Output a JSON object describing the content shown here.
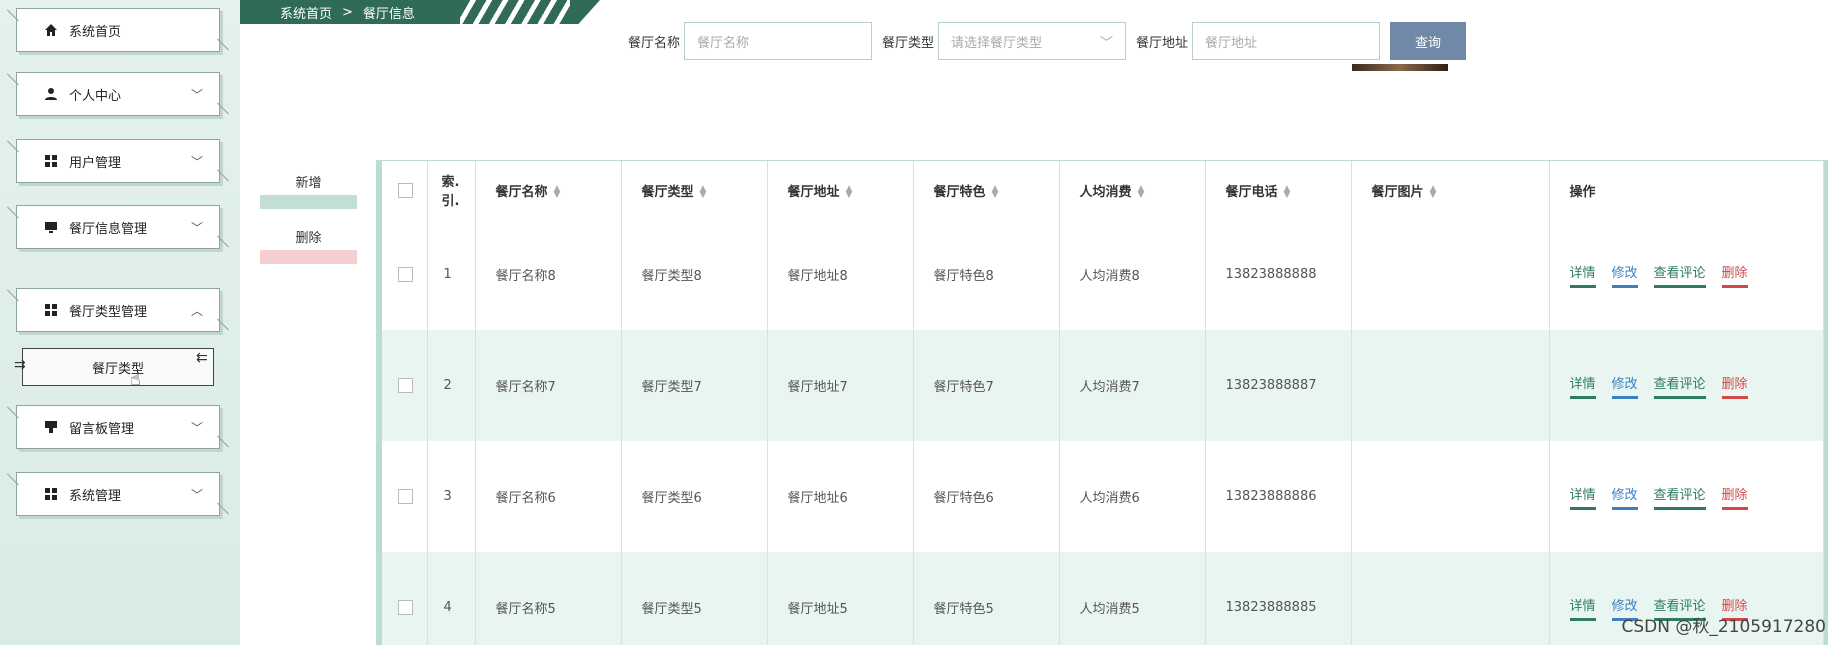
{
  "sidebar": {
    "items": [
      {
        "label": "系统首页",
        "icon": "home-icon",
        "chevron": ""
      },
      {
        "label": "个人中心",
        "icon": "user-icon",
        "chevron": "﹀"
      },
      {
        "label": "用户管理",
        "icon": "grid-icon",
        "chevron": "﹀"
      },
      {
        "label": "餐厅信息管理",
        "icon": "monitor-icon",
        "chevron": "﹀"
      },
      {
        "label": "餐厅类型管理",
        "icon": "grid-icon",
        "chevron": "︿"
      },
      {
        "label": "留言板管理",
        "icon": "board-icon",
        "chevron": "﹀"
      },
      {
        "label": "系统管理",
        "icon": "grid-icon",
        "chevron": "﹀"
      }
    ],
    "subitem": {
      "label": "餐厅类型"
    }
  },
  "breadcrumb": {
    "home": "系统首页",
    "separator": ">",
    "current": "餐厅信息"
  },
  "search": {
    "name_label": "餐厅名称",
    "name_placeholder": "餐厅名称",
    "type_label": "餐厅类型",
    "type_placeholder": "请选择餐厅类型",
    "address_label": "餐厅地址",
    "address_placeholder": "餐厅地址",
    "query_button": "查询"
  },
  "actions": {
    "add": "新增",
    "delete": "删除",
    "add_color": "#c3ded4",
    "delete_color": "#f5cfcf"
  },
  "table": {
    "columns": [
      "索.引.",
      "餐厅名称",
      "餐厅类型",
      "餐厅地址",
      "餐厅特色",
      "人均消费",
      "餐厅电话",
      "餐厅图片",
      "操作"
    ],
    "rows": [
      {
        "index": "1",
        "name": "餐厅名称8",
        "type": "餐厅类型8",
        "address": "餐厅地址8",
        "feature": "餐厅特色8",
        "cost": "人均消费8",
        "phone": "13823888888"
      },
      {
        "index": "2",
        "name": "餐厅名称7",
        "type": "餐厅类型7",
        "address": "餐厅地址7",
        "feature": "餐厅特色7",
        "cost": "人均消费7",
        "phone": "13823888887"
      },
      {
        "index": "3",
        "name": "餐厅名称6",
        "type": "餐厅类型6",
        "address": "餐厅地址6",
        "feature": "餐厅特色6",
        "cost": "人均消费6",
        "phone": "13823888886"
      },
      {
        "index": "4",
        "name": "餐厅名称5",
        "type": "餐厅类型5",
        "address": "餐厅地址5",
        "feature": "餐厅特色5",
        "cost": "人均消费5",
        "phone": "13823888885"
      }
    ],
    "ops": {
      "detail": "详情",
      "edit": "修改",
      "review": "查看评论",
      "delete": "删除"
    }
  },
  "watermark": "CSDN @秋_2105917280"
}
